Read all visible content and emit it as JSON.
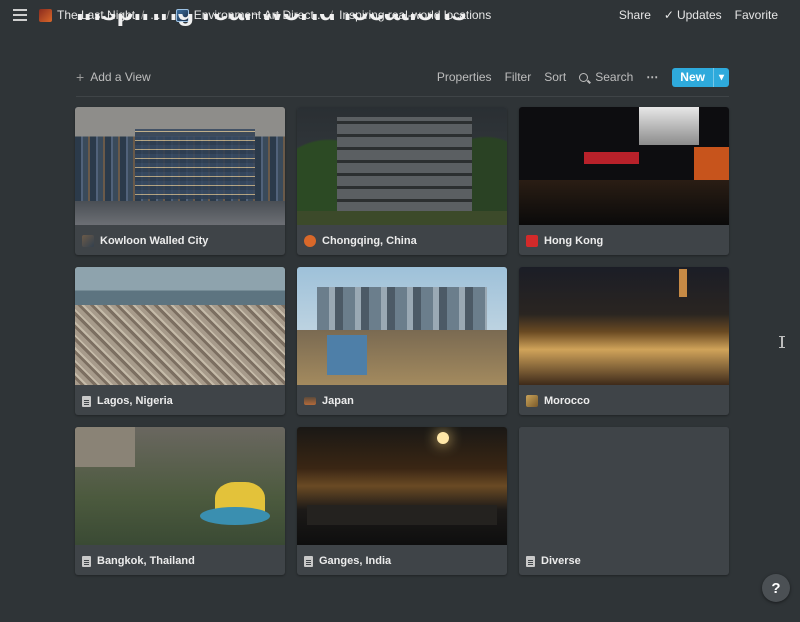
{
  "topbar": {
    "breadcrumbs": [
      "The Last Night",
      "...",
      "Environment Art Direct...",
      "Inspiring real-world locations"
    ],
    "share": "Share",
    "updates": "Updates",
    "favorite": "Favorite"
  },
  "page": {
    "title": "Inspiring real-world locations"
  },
  "toolbar": {
    "add_view": "Add a View",
    "properties": "Properties",
    "filter": "Filter",
    "sort": "Sort",
    "search": "Search",
    "more": "⋯",
    "new": "New"
  },
  "cards": [
    {
      "label": "Kowloon Walled City"
    },
    {
      "label": "Chongqing, China"
    },
    {
      "label": "Hong Kong"
    },
    {
      "label": "Lagos, Nigeria"
    },
    {
      "label": "Japan"
    },
    {
      "label": "Morocco"
    },
    {
      "label": "Bangkok, Thailand"
    },
    {
      "label": "Ganges, India"
    },
    {
      "label": "Diverse"
    }
  ],
  "help": {
    "label": "?"
  },
  "colors": {
    "accent": "#2eaadc",
    "background": "#2f3437",
    "card": "#3f4448"
  }
}
